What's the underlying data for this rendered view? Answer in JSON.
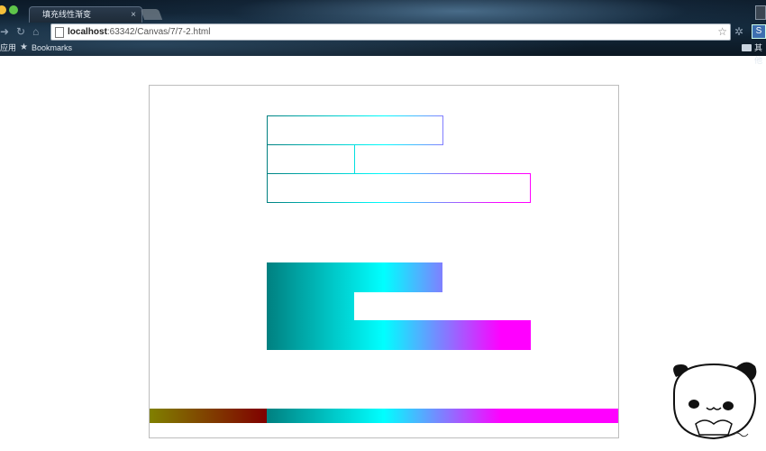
{
  "browser": {
    "tab": {
      "title": "填充线性渐变",
      "close_glyph": "×"
    },
    "address_bar": {
      "host": "localhost",
      "path": ":63342/Canvas/7/7-2.html"
    },
    "bookmarks": {
      "apps_label": "应用",
      "bookmarks_label": "Bookmarks",
      "other_label": "其他"
    },
    "icons": {
      "forward": "arrow-right-icon",
      "reload": "reload-icon",
      "home": "home-icon",
      "star": "star-icon",
      "settings": "gear-icon",
      "extension": "extension-icon",
      "folder": "folder-icon"
    }
  },
  "canvas": {
    "gradient_stops": [
      {
        "offset": 0.0,
        "color": "#808000"
      },
      {
        "offset": 0.25,
        "color": "#800000"
      },
      {
        "offset": 0.25,
        "color": "#008080"
      },
      {
        "offset": 0.5,
        "color": "#00ffff"
      },
      {
        "offset": 0.75,
        "color": "#ff00ff"
      },
      {
        "offset": 1.0,
        "color": "#ff00ff"
      }
    ]
  }
}
